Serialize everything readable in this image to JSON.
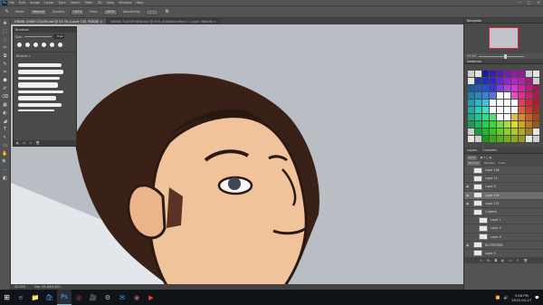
{
  "app": {
    "logo": "Ps"
  },
  "menu": [
    "File",
    "Edit",
    "Image",
    "Layer",
    "Type",
    "Select",
    "Filter",
    "3D",
    "View",
    "Window",
    "Help"
  ],
  "window_controls": [
    "—",
    "□",
    "✕"
  ],
  "options": {
    "mode_label": "Mode:",
    "mode_value": "Normal",
    "opacity_label": "Opacity:",
    "opacity_value": "100%",
    "flow_label": "Flow:",
    "flow_value": "100%",
    "smoothing_label": "Smoothing:"
  },
  "tabs": [
    {
      "label": "DRAWL JENNY COLOR.psd @ 33.3% (Layer 135, RGB/8) ×",
      "active": true
    },
    {
      "label": "DRAWL FLAVOR NEW.psd @ 50% (Hue/Saturation 1, Layer Mask/8) ×",
      "active": false
    }
  ],
  "tools": [
    "✥",
    "⬚",
    "◌",
    "✂",
    "⧉",
    "✎",
    "♒",
    "⬣",
    "✐",
    "⌫",
    "▦",
    "◐",
    "◢",
    "T",
    "↖",
    "▭",
    "✋",
    "🔍",
    "⋯",
    "◧"
  ],
  "brush_panel": {
    "title": "Brushes",
    "size_label": "Size:",
    "size_value": "8 px",
    "folder_label": "Brushes 1"
  },
  "navigator": {
    "title": "Navigator",
    "zoom": "33.3%"
  },
  "swatches": {
    "title": "Swatches"
  },
  "layers_panel": {
    "tabs": [
      "Layers",
      "Channels"
    ],
    "kind_label": "Kind",
    "blend": "Normal",
    "opacity_label": "Opacity:",
    "lock_label": "Lock:",
    "fill_label": "Fill:",
    "layers": [
      {
        "name": "Layer 148",
        "visible": false,
        "active": false,
        "indent": false
      },
      {
        "name": "Layer 12",
        "visible": false,
        "active": false,
        "indent": false
      },
      {
        "name": "Layer 8",
        "visible": true,
        "active": false,
        "indent": false
      },
      {
        "name": "Layer 135",
        "visible": true,
        "active": true,
        "indent": false
      },
      {
        "name": "Layer 132",
        "visible": true,
        "active": false,
        "indent": false
      },
      {
        "name": "1 sketch",
        "visible": false,
        "active": false,
        "indent": false
      },
      {
        "name": "Layer 1",
        "visible": false,
        "active": false,
        "indent": true
      },
      {
        "name": "Layer 3",
        "visible": false,
        "active": false,
        "indent": true
      },
      {
        "name": "Layer 4",
        "visible": false,
        "active": false,
        "indent": true
      },
      {
        "name": "BG FRATERN",
        "visible": true,
        "active": false,
        "indent": false
      },
      {
        "name": "Layer 5",
        "visible": false,
        "active": false,
        "indent": false
      }
    ]
  },
  "status": {
    "zoom": "33.33%",
    "doc": "Doc: 99.4M/5.82G"
  },
  "taskbar": {
    "icons": [
      "e",
      "📁",
      "🛍",
      "Ps",
      "◎",
      "🎥",
      "⚙",
      "✉",
      "◉",
      "▶"
    ]
  },
  "tray": {
    "time": "3:56 PM",
    "date": "2019-04-27"
  },
  "colors": {
    "skin": "#f1c39a",
    "hair": "#3a2118",
    "bg": "#b9bdc4",
    "accent": "#31a8ff"
  }
}
